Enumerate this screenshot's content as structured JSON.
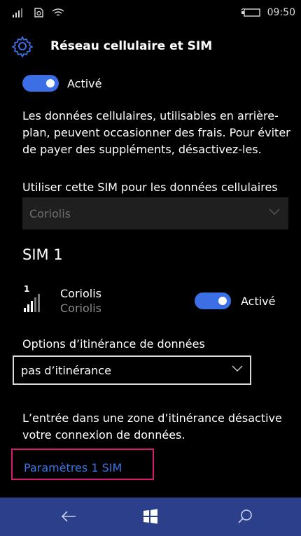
{
  "status_bar": {
    "icons": [
      "signal-icon",
      "sim-icon",
      "wifi-icon",
      "battery-icon"
    ],
    "time": "09:50"
  },
  "header": {
    "title": "Réseau cellulaire et SIM",
    "icon": "gear-icon"
  },
  "cellular": {
    "toggle_label": "Activé",
    "toggle_on": true,
    "description": "Les données cellulaires, utilisables en arrière-plan, peuvent occasionner des frais. Pour éviter de payer des suppléments, désactivez-les.",
    "sim_select_label": "Utiliser cette SIM pour les données cellulaires",
    "sim_select_value": "Coriolis"
  },
  "sim1": {
    "heading": "SIM 1",
    "signal_index": "1",
    "operator": "Coriolis",
    "operator_sub": "Coriolis",
    "toggle_label": "Activé",
    "toggle_on": true,
    "roaming_label": "Options d’itinérance de données",
    "roaming_value": "pas d’itinérance",
    "roaming_note": "L’entrée dans une zone d’itinérance désactive votre connexion de données.",
    "settings_link": "Paramètres 1 SIM"
  },
  "nav": {
    "back_icon": "back-arrow-icon",
    "home_icon": "windows-icon",
    "search_icon": "search-icon"
  },
  "colors": {
    "accent": "#3c6fe6",
    "link": "#3b73e8",
    "highlight": "#d81b6c",
    "navbar": "#2c3f8b"
  }
}
